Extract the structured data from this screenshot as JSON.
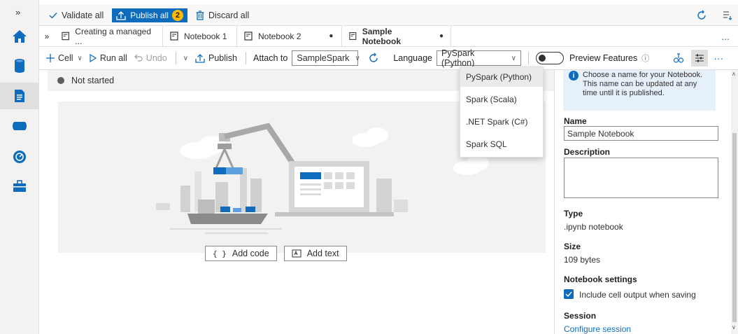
{
  "topbar": {
    "validate_label": "Validate all",
    "publish_label": "Publish all",
    "publish_count": "2",
    "discard_label": "Discard all"
  },
  "tabs": [
    {
      "label": "Creating a managed ...",
      "dirty": false
    },
    {
      "label": "Notebook 1",
      "dirty": false
    },
    {
      "label": "Notebook 2",
      "dirty": true
    },
    {
      "label": "Sample Notebook",
      "dirty": true
    }
  ],
  "tabs_more": "...",
  "toolbar": {
    "cell_label": "Cell",
    "run_all_label": "Run all",
    "undo_label": "Undo",
    "publish_label": "Publish",
    "attach_to_label": "Attach to",
    "attach_to_value": "SampleSpark",
    "language_label": "Language",
    "language_value": "PySpark (Python)",
    "preview_label": "Preview Features"
  },
  "language_menu": {
    "options": [
      "PySpark (Python)",
      "Spark (Scala)",
      ".NET Spark (C#)",
      "Spark SQL"
    ],
    "selected": "PySpark (Python)"
  },
  "main": {
    "status": "Not started",
    "add_code_label": "Add code",
    "add_text_label": "Add text"
  },
  "panel": {
    "info_text": "Choose a name for your Notebook. This name can be updated at any time until it is published.",
    "name_label": "Name",
    "name_value": "Sample Notebook",
    "description_label": "Description",
    "description_value": "",
    "type_label": "Type",
    "type_value": ".ipynb notebook",
    "size_label": "Size",
    "size_value": "109 bytes",
    "settings_label": "Notebook settings",
    "include_output_label": "Include cell output when saving",
    "include_output_checked": true,
    "session_label": "Session",
    "configure_session_label": "Configure session"
  },
  "colors": {
    "accent": "#0f6cbd",
    "badge": "#ffb900"
  }
}
